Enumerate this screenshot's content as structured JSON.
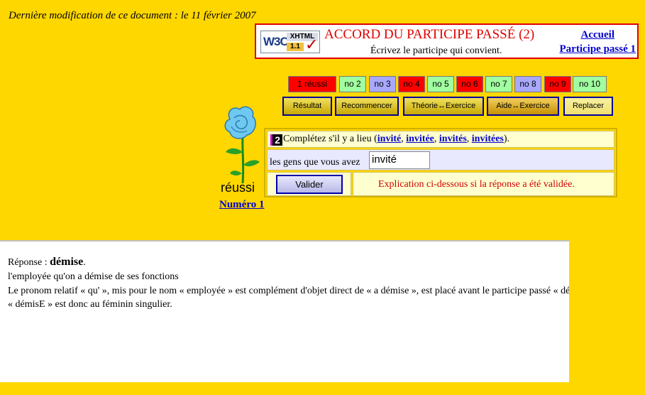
{
  "last_modified": "Dernière modification de ce document : le 11 février 2007",
  "header": {
    "badge": {
      "w3c": "W3C",
      "xhtml": "XHTML",
      "version": "1.1"
    },
    "title": "ACCORD DU PARTICIPE PASSÉ (2)",
    "subtitle": "Écrivez le participe qui convient.",
    "nav": [
      {
        "label": "Accueil"
      },
      {
        "label": "Participe passé 1"
      }
    ]
  },
  "question_buttons": [
    {
      "label": "1 réussi",
      "color": "#ff0000"
    },
    {
      "label": "no 2",
      "color": "#a0ffa0"
    },
    {
      "label": "no 3",
      "color": "#a8a8ff"
    },
    {
      "label": "no 4",
      "color": "#ff0000"
    },
    {
      "label": "no 5",
      "color": "#a0ffa0"
    },
    {
      "label": "no 6",
      "color": "#ff0000"
    },
    {
      "label": "no 7",
      "color": "#a0ffa0"
    },
    {
      "label": "no 8",
      "color": "#a8a8ff"
    },
    {
      "label": "no 9",
      "color": "#ff0000"
    },
    {
      "label": "no 10",
      "color": "#a0ffa0"
    }
  ],
  "action_buttons": [
    {
      "label": "Résultat"
    },
    {
      "label": "Recommencer"
    },
    {
      "label": "Théorie↔Exercice"
    },
    {
      "label": "Aide↔Exercice"
    },
    {
      "label": "Replacer"
    }
  ],
  "status": {
    "label": "réussi",
    "link": "Numéro 1"
  },
  "exercise": {
    "number": "2",
    "instruction_prefix": "Complétez s'il y a lieu (",
    "choices": [
      "invité",
      "invitée",
      "invités",
      "invitées"
    ],
    "instruction_suffix": ").",
    "prompt": "les gens que vous avez",
    "answer_value": "invité",
    "validate_label": "Valider",
    "explanation_note": "Explication ci-dessous si la réponse a été validée."
  },
  "response": {
    "label": "Réponse : ",
    "answer": "démise",
    "answer_end": ".",
    "example": "l'employée qu'on a démise de ses fonctions",
    "explanation_1": "Le pronom relatif « qu' », mis pour le nom « employée » est complément d'objet direct de « a démise », est placé avant le participe passé « démise » et",
    "explanation_2": "« démisE » est donc au féminin singulier."
  },
  "colors": {
    "page_bg": "#ffd700",
    "title_red": "#e00000",
    "link_blue": "#0000cc"
  }
}
